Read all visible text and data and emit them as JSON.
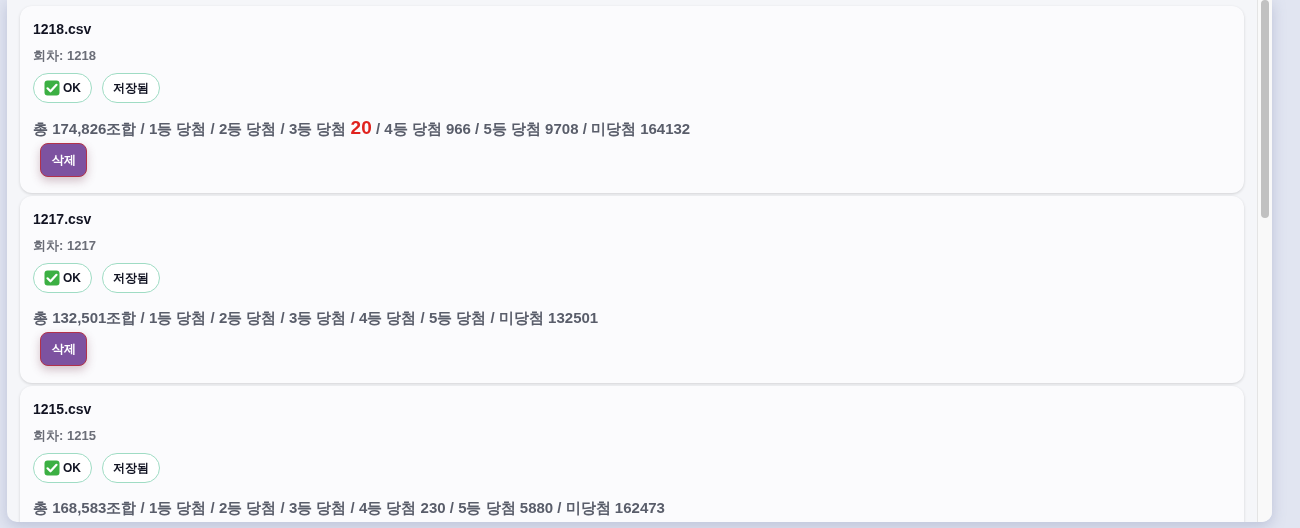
{
  "files": [
    {
      "name": "1218.csv",
      "round_label": "회차: 1218",
      "status": "OK",
      "saved_label": "저장됨",
      "summary": [
        {
          "text": "총 174,826조합 / 1등 당첨 / 2등 당첨 / 3등 당첨 ",
          "highlight": false
        },
        {
          "text": "20",
          "highlight": true
        },
        {
          "text": " / 4등 당첨 966 / 5등 당첨 9708 / 미당첨 164132",
          "highlight": false
        }
      ],
      "delete_label": "삭제"
    },
    {
      "name": "1217.csv",
      "round_label": "회차: 1217",
      "status": "OK",
      "saved_label": "저장됨",
      "summary": [
        {
          "text": "총 132,501조합 / 1등 당첨 / 2등 당첨 / 3등 당첨 / 4등 당첨 / 5등 당첨 / 미당첨 132501",
          "highlight": false
        }
      ],
      "delete_label": "삭제"
    },
    {
      "name": "1215.csv",
      "round_label": "회차: 1215",
      "status": "OK",
      "saved_label": "저장됨",
      "summary": [
        {
          "text": "총 168,583조합 / 1등 당첨 / 2등 당첨 / 3등 당첨 / 4등 당첨 230 / 5등 당첨 5880 / 미당첨 162473",
          "highlight": false
        }
      ]
    }
  ]
}
